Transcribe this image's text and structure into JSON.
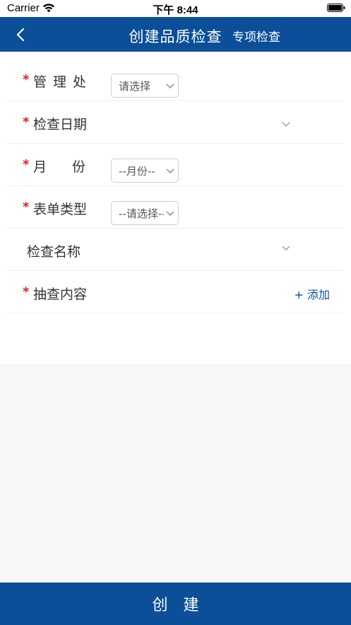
{
  "status_bar": {
    "carrier": "Carrier",
    "time": "下午 8:44"
  },
  "nav": {
    "title": "创建品质检查",
    "right_label": "专项检查"
  },
  "form": {
    "rows": [
      {
        "label": "管理处",
        "required": "*",
        "control": "select",
        "value": "请选择"
      },
      {
        "label": "检查日期",
        "required": "*",
        "control": "dropdown"
      },
      {
        "label": "月份",
        "required": "*",
        "control": "select",
        "value": "--月份--"
      },
      {
        "label": "表单类型",
        "required": "*",
        "control": "select",
        "value": "--请选择--"
      },
      {
        "label": "检查名称",
        "required": "",
        "control": "dropdown"
      },
      {
        "label": "抽查内容",
        "required": "*",
        "control": "add",
        "add_label": "+ 添加"
      }
    ]
  },
  "submit": {
    "label": "创建"
  },
  "colors": {
    "primary": "#0b4f98",
    "required": "#e02020",
    "background": "#f7f7f7"
  },
  "icons": {
    "back": "chevron-left-icon",
    "dropdown": "chevron-down-icon",
    "wifi": "wifi-icon",
    "battery": "battery-icon"
  }
}
